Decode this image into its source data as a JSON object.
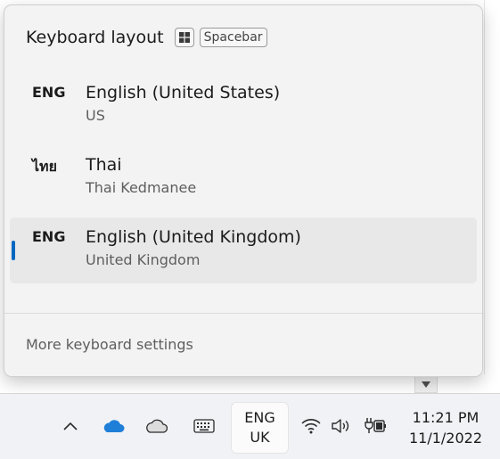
{
  "flyout": {
    "title": "Keyboard layout",
    "win_key_icon": "windows-logo-icon",
    "shortcut_key": "Spacebar",
    "languages": [
      {
        "code": "ENG",
        "name": "English (United States)",
        "layout": "US",
        "selected": false
      },
      {
        "code": "ไทย",
        "name": "Thai",
        "layout": "Thai Kedmanee",
        "selected": false
      },
      {
        "code": "ENG",
        "name": "English (United Kingdom)",
        "layout": "United Kingdom",
        "selected": true
      }
    ],
    "more_settings": "More keyboard settings",
    "accent_color": "#0067c0"
  },
  "taskbar": {
    "tray_icons": [
      "chevron-up-icon",
      "onedrive-blue-icon",
      "onedrive-gray-icon",
      "touch-keyboard-icon",
      "wifi-icon",
      "volume-icon",
      "battery-charging-icon"
    ],
    "ime": {
      "line1": "ENG",
      "line2": "UK"
    },
    "time": "11:21 PM",
    "date": "11/1/2022"
  }
}
